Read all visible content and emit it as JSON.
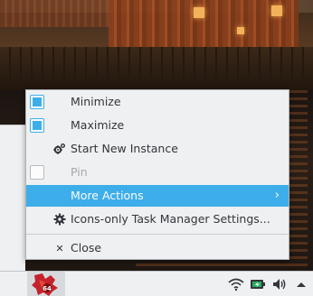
{
  "menu": {
    "items": [
      {
        "label": "Minimize",
        "lead": "checkbox",
        "checked": true,
        "disabled": false
      },
      {
        "label": "Maximize",
        "lead": "checkbox",
        "checked": true,
        "disabled": false
      },
      {
        "label": "Start New Instance",
        "icon": "gears-icon",
        "disabled": false
      },
      {
        "label": "Pin",
        "lead": "checkbox",
        "checked": false,
        "disabled": true
      },
      {
        "label": "More Actions",
        "highlighted": true,
        "submenu_arrow": "›"
      },
      {
        "label": "Icons-only Task Manager Settings...",
        "icon": "gear-icon"
      },
      {
        "label": "Close",
        "icon": "close-icon",
        "glyph": "✕"
      }
    ]
  },
  "taskbar": {
    "app_badge": "64",
    "tray": [
      "network-wifi-icon",
      "battery-icon",
      "volume-icon",
      "panel-expand-arrow-icon"
    ]
  },
  "colors": {
    "highlight": "#3daee9",
    "menu_bg": "#eff0f1",
    "text": "#31363b",
    "disabled_text": "#a5a8ab"
  }
}
